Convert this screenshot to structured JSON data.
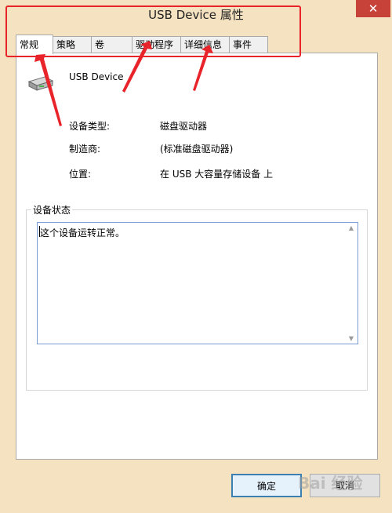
{
  "window": {
    "title": "USB Device 属性",
    "close_glyph": "✕"
  },
  "tabs": [
    {
      "label": "常规",
      "active": true
    },
    {
      "label": "策略"
    },
    {
      "label": "卷"
    },
    {
      "label": "驱动程序"
    },
    {
      "label": "详细信息"
    },
    {
      "label": "事件"
    }
  ],
  "device": {
    "name": "USB Device",
    "icon": "usb-drive-icon"
  },
  "properties": [
    {
      "label": "设备类型:",
      "value": "磁盘驱动器"
    },
    {
      "label": "制造商:",
      "value": "(标准磁盘驱动器)"
    },
    {
      "label": "位置:",
      "value": "在 USB 大容量存储设备 上"
    }
  ],
  "device_status": {
    "group_label": "设备状态",
    "text": "这个设备运转正常。"
  },
  "buttons": {
    "ok": "确定",
    "cancel": "取消"
  },
  "watermark": "Bai 经验",
  "colors": {
    "annotation": "#e8232a",
    "window_bg": "#f4e2c1",
    "close_button": "#c7433a"
  }
}
